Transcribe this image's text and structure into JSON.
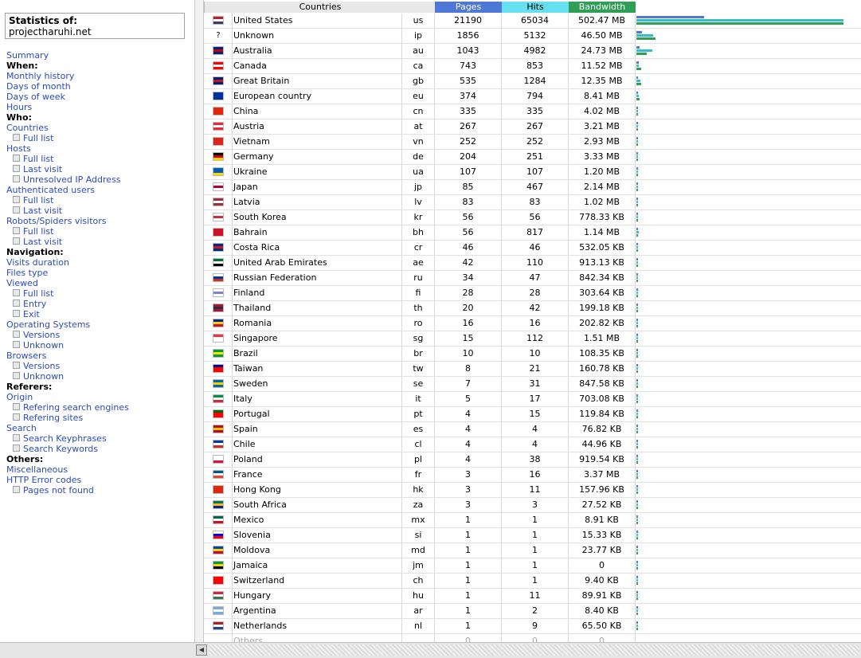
{
  "nav": {
    "stats_title": "Statistics of:",
    "site": "projectharuhi.net",
    "menu": [
      {
        "label": "Summary",
        "kind": "link"
      },
      {
        "label": "When:",
        "kind": "head"
      },
      {
        "label": "Monthly history",
        "kind": "link"
      },
      {
        "label": "Days of month",
        "kind": "link"
      },
      {
        "label": "Days of week",
        "kind": "link"
      },
      {
        "label": "Hours",
        "kind": "link"
      },
      {
        "label": "Who:",
        "kind": "head"
      },
      {
        "label": "Countries",
        "kind": "link"
      },
      {
        "label": "Full list",
        "kind": "sub"
      },
      {
        "label": "Hosts",
        "kind": "link"
      },
      {
        "label": "Full list",
        "kind": "sub"
      },
      {
        "label": "Last visit",
        "kind": "sub"
      },
      {
        "label": "Unresolved IP Address",
        "kind": "sub"
      },
      {
        "label": "Authenticated users",
        "kind": "link"
      },
      {
        "label": "Full list",
        "kind": "sub"
      },
      {
        "label": "Last visit",
        "kind": "sub"
      },
      {
        "label": "Robots/Spiders visitors",
        "kind": "link"
      },
      {
        "label": "Full list",
        "kind": "sub"
      },
      {
        "label": "Last visit",
        "kind": "sub"
      },
      {
        "label": "Navigation:",
        "kind": "head"
      },
      {
        "label": "Visits duration",
        "kind": "link"
      },
      {
        "label": "Files type",
        "kind": "link"
      },
      {
        "label": "Viewed",
        "kind": "link"
      },
      {
        "label": "Full list",
        "kind": "sub"
      },
      {
        "label": "Entry",
        "kind": "sub"
      },
      {
        "label": "Exit",
        "kind": "sub"
      },
      {
        "label": "Operating Systems",
        "kind": "link"
      },
      {
        "label": "Versions",
        "kind": "sub"
      },
      {
        "label": "Unknown",
        "kind": "sub"
      },
      {
        "label": "Browsers",
        "kind": "link"
      },
      {
        "label": "Versions",
        "kind": "sub"
      },
      {
        "label": "Unknown",
        "kind": "sub"
      },
      {
        "label": "Referers:",
        "kind": "head"
      },
      {
        "label": "Origin",
        "kind": "link"
      },
      {
        "label": "Refering search engines",
        "kind": "sub"
      },
      {
        "label": "Refering sites",
        "kind": "sub"
      },
      {
        "label": "Search",
        "kind": "link"
      },
      {
        "label": "Search Keyphrases",
        "kind": "sub"
      },
      {
        "label": "Search Keywords",
        "kind": "sub"
      },
      {
        "label": "Others:",
        "kind": "head"
      },
      {
        "label": "Miscellaneous",
        "kind": "link"
      },
      {
        "label": "HTTP Error codes",
        "kind": "link"
      },
      {
        "label": "Pages not found",
        "kind": "sub"
      }
    ]
  },
  "table": {
    "headers": {
      "countries": "Countries",
      "pages": "Pages",
      "hits": "Hits",
      "bandwidth": "Bandwidth"
    },
    "colors": {
      "pages": "#4e77d6",
      "hits": "#66dfee",
      "bandwidth": "#2e9f55"
    },
    "rows": [
      {
        "country": "United States",
        "code": "us",
        "pages": 21190,
        "hits": 65034,
        "bandwidth": "502.47 MB",
        "flag": [
          "#b22234",
          "#ffffff",
          "#3c3b6e"
        ]
      },
      {
        "country": "Unknown",
        "code": "ip",
        "pages": 1856,
        "hits": 5132,
        "bandwidth": "46.50 MB",
        "flag": [
          "#ffffff",
          "#ffffff",
          "#ffffff"
        ]
      },
      {
        "country": "Australia",
        "code": "au",
        "pages": 1043,
        "hits": 4982,
        "bandwidth": "24.73 MB",
        "flag": [
          "#00247d",
          "#cc0000",
          "#00247d"
        ]
      },
      {
        "country": "Canada",
        "code": "ca",
        "pages": 743,
        "hits": 853,
        "bandwidth": "11.52 MB",
        "flag": [
          "#ff0000",
          "#ffffff",
          "#ff0000"
        ]
      },
      {
        "country": "Great Britain",
        "code": "gb",
        "pages": 535,
        "hits": 1284,
        "bandwidth": "12.35 MB",
        "flag": [
          "#012169",
          "#c8102e",
          "#012169"
        ]
      },
      {
        "country": "European country",
        "code": "eu",
        "pages": 374,
        "hits": 794,
        "bandwidth": "8.41 MB",
        "flag": [
          "#003399",
          "#003399",
          "#003399"
        ]
      },
      {
        "country": "China",
        "code": "cn",
        "pages": 335,
        "hits": 335,
        "bandwidth": "4.02 MB",
        "flag": [
          "#de2910",
          "#de2910",
          "#de2910"
        ]
      },
      {
        "country": "Austria",
        "code": "at",
        "pages": 267,
        "hits": 267,
        "bandwidth": "3.21 MB",
        "flag": [
          "#ed2939",
          "#ffffff",
          "#ed2939"
        ]
      },
      {
        "country": "Vietnam",
        "code": "vn",
        "pages": 252,
        "hits": 252,
        "bandwidth": "2.93 MB",
        "flag": [
          "#da251d",
          "#da251d",
          "#da251d"
        ]
      },
      {
        "country": "Germany",
        "code": "de",
        "pages": 204,
        "hits": 251,
        "bandwidth": "3.33 MB",
        "flag": [
          "#000000",
          "#dd0000",
          "#ffce00"
        ]
      },
      {
        "country": "Ukraine",
        "code": "ua",
        "pages": 107,
        "hits": 107,
        "bandwidth": "1.20 MB",
        "flag": [
          "#005bbb",
          "#005bbb",
          "#ffd500"
        ]
      },
      {
        "country": "Japan",
        "code": "jp",
        "pages": 85,
        "hits": 467,
        "bandwidth": "2.14 MB",
        "flag": [
          "#ffffff",
          "#bc002d",
          "#ffffff"
        ]
      },
      {
        "country": "Latvia",
        "code": "lv",
        "pages": 83,
        "hits": 83,
        "bandwidth": "1.02 MB",
        "flag": [
          "#9e3039",
          "#ffffff",
          "#9e3039"
        ]
      },
      {
        "country": "South Korea",
        "code": "kr",
        "pages": 56,
        "hits": 56,
        "bandwidth": "778.33 KB",
        "flag": [
          "#ffffff",
          "#cd2e3a",
          "#ffffff"
        ]
      },
      {
        "country": "Bahrain",
        "code": "bh",
        "pages": 56,
        "hits": 817,
        "bandwidth": "1.14 MB",
        "flag": [
          "#ce1126",
          "#ce1126",
          "#ce1126"
        ]
      },
      {
        "country": "Costa Rica",
        "code": "cr",
        "pages": 46,
        "hits": 46,
        "bandwidth": "532.05 KB",
        "flag": [
          "#002b7f",
          "#ce1126",
          "#002b7f"
        ]
      },
      {
        "country": "United Arab Emirates",
        "code": "ae",
        "pages": 42,
        "hits": 110,
        "bandwidth": "913.13 KB",
        "flag": [
          "#00732f",
          "#ffffff",
          "#000000"
        ]
      },
      {
        "country": "Russian Federation",
        "code": "ru",
        "pages": 34,
        "hits": 47,
        "bandwidth": "842.34 KB",
        "flag": [
          "#ffffff",
          "#0039a6",
          "#d52b1e"
        ]
      },
      {
        "country": "Finland",
        "code": "fi",
        "pages": 28,
        "hits": 28,
        "bandwidth": "303.64 KB",
        "flag": [
          "#ffffff",
          "#7f7fd8",
          "#ffffff"
        ]
      },
      {
        "country": "Thailand",
        "code": "th",
        "pages": 20,
        "hits": 42,
        "bandwidth": "199.18 KB",
        "flag": [
          "#a51931",
          "#2d2a4a",
          "#a51931"
        ]
      },
      {
        "country": "Romania",
        "code": "ro",
        "pages": 16,
        "hits": 16,
        "bandwidth": "202.82 KB",
        "flag": [
          "#002b7f",
          "#fcd116",
          "#ce1126"
        ]
      },
      {
        "country": "Singapore",
        "code": "sg",
        "pages": 15,
        "hits": 112,
        "bandwidth": "1.51 MB",
        "flag": [
          "#ef3340",
          "#ffffff",
          "#ffffff"
        ]
      },
      {
        "country": "Brazil",
        "code": "br",
        "pages": 10,
        "hits": 10,
        "bandwidth": "108.35 KB",
        "flag": [
          "#009c3b",
          "#ffdf00",
          "#009c3b"
        ]
      },
      {
        "country": "Taiwan",
        "code": "tw",
        "pages": 8,
        "hits": 21,
        "bandwidth": "160.78 KB",
        "flag": [
          "#000095",
          "#fe0000",
          "#fe0000"
        ]
      },
      {
        "country": "Sweden",
        "code": "se",
        "pages": 7,
        "hits": 31,
        "bandwidth": "847.58 KB",
        "flag": [
          "#006aa7",
          "#fecc00",
          "#006aa7"
        ]
      },
      {
        "country": "Italy",
        "code": "it",
        "pages": 5,
        "hits": 17,
        "bandwidth": "703.08 KB",
        "flag": [
          "#009246",
          "#ffffff",
          "#ce2b37"
        ]
      },
      {
        "country": "Portugal",
        "code": "pt",
        "pages": 4,
        "hits": 15,
        "bandwidth": "119.84 KB",
        "flag": [
          "#006600",
          "#ff0000",
          "#ff0000"
        ]
      },
      {
        "country": "Spain",
        "code": "es",
        "pages": 4,
        "hits": 4,
        "bandwidth": "76.82 KB",
        "flag": [
          "#aa151b",
          "#f1bf00",
          "#aa151b"
        ]
      },
      {
        "country": "Chile",
        "code": "cl",
        "pages": 4,
        "hits": 4,
        "bandwidth": "44.96 KB",
        "flag": [
          "#0039a6",
          "#ffffff",
          "#d52b1e"
        ]
      },
      {
        "country": "Poland",
        "code": "pl",
        "pages": 4,
        "hits": 38,
        "bandwidth": "919.54 KB",
        "flag": [
          "#ffffff",
          "#ffffff",
          "#dc143c"
        ]
      },
      {
        "country": "France",
        "code": "fr",
        "pages": 3,
        "hits": 16,
        "bandwidth": "3.37 MB",
        "flag": [
          "#0055a4",
          "#ffffff",
          "#ef4135"
        ]
      },
      {
        "country": "Hong Kong",
        "code": "hk",
        "pages": 3,
        "hits": 11,
        "bandwidth": "157.96 KB",
        "flag": [
          "#de2910",
          "#de2910",
          "#de2910"
        ]
      },
      {
        "country": "South Africa",
        "code": "za",
        "pages": 3,
        "hits": 3,
        "bandwidth": "27.52 KB",
        "flag": [
          "#007a4d",
          "#ffb612",
          "#002395"
        ]
      },
      {
        "country": "Mexico",
        "code": "mx",
        "pages": 1,
        "hits": 1,
        "bandwidth": "8.91 KB",
        "flag": [
          "#006847",
          "#ffffff",
          "#ce1126"
        ]
      },
      {
        "country": "Slovenia",
        "code": "si",
        "pages": 1,
        "hits": 1,
        "bandwidth": "15.33 KB",
        "flag": [
          "#ffffff",
          "#0000ff",
          "#ff0000"
        ]
      },
      {
        "country": "Moldova",
        "code": "md",
        "pages": 1,
        "hits": 1,
        "bandwidth": "23.77 KB",
        "flag": [
          "#0046ae",
          "#ffd200",
          "#cc092f"
        ]
      },
      {
        "country": "Jamaica",
        "code": "jm",
        "pages": 1,
        "hits": 1,
        "bandwidth": "0",
        "flag": [
          "#009b3a",
          "#fed100",
          "#000000"
        ]
      },
      {
        "country": "Switzerland",
        "code": "ch",
        "pages": 1,
        "hits": 1,
        "bandwidth": "9.40 KB",
        "flag": [
          "#ff0000",
          "#ff0000",
          "#ff0000"
        ]
      },
      {
        "country": "Hungary",
        "code": "hu",
        "pages": 1,
        "hits": 11,
        "bandwidth": "89.91 KB",
        "flag": [
          "#ce2939",
          "#ffffff",
          "#477050"
        ]
      },
      {
        "country": "Argentina",
        "code": "ar",
        "pages": 1,
        "hits": 2,
        "bandwidth": "8.40 KB",
        "flag": [
          "#74acdf",
          "#ffffff",
          "#74acdf"
        ]
      },
      {
        "country": "Netherlands",
        "code": "nl",
        "pages": 1,
        "hits": 9,
        "bandwidth": "65.50 KB",
        "flag": [
          "#ae1c28",
          "#ffffff",
          "#21468b"
        ]
      },
      {
        "country": "Others",
        "code": "",
        "pages": 0,
        "hits": 0,
        "bandwidth": "0",
        "flag": [
          "#ffffff",
          "#ffffff",
          "#ffffff"
        ]
      }
    ]
  },
  "scrollbar": {
    "left_arrow_icon": "arrow-left-icon"
  }
}
